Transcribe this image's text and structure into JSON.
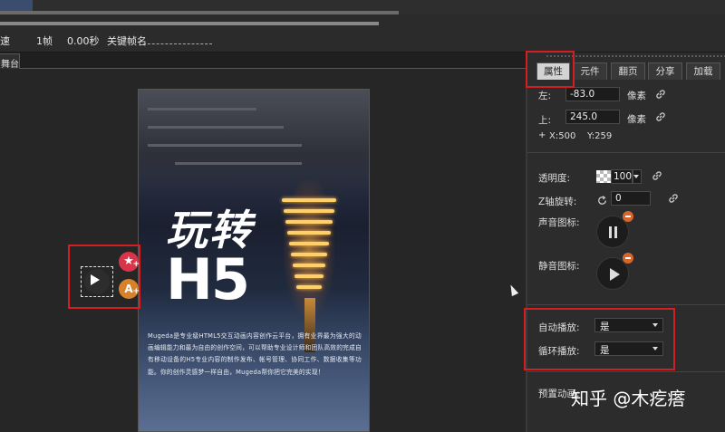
{
  "timeline": {
    "speed_label": "速",
    "frame_label": "1帧",
    "time_label": "0.00秒",
    "keyframe_name_label": "关键帧名"
  },
  "stage": {
    "tab_label": "舞台",
    "title_cn": "玩转",
    "title_h5": "H5",
    "description": "Mugeda是专业级HTML5交互动画内容创作云平台，拥有业界最为强大的动画编辑能力和最为自由的创作空间，可以帮助专业设计师和团队高效的完成自有移动设备的H5专业内容的制作发布、帐号管理、协同工作、数据收集等功能。你的创作灵感梦一样自由，Mugeda帮你把它完美的实现！"
  },
  "panel": {
    "tabs": [
      {
        "label": "属性",
        "active": true
      },
      {
        "label": "元件",
        "active": false
      },
      {
        "label": "翻页",
        "active": false
      },
      {
        "label": "分享",
        "active": false
      },
      {
        "label": "加载",
        "active": false
      }
    ],
    "left_label": "左:",
    "left_value": "-83.0",
    "top_label": "上:",
    "top_value": "245.0",
    "unit_px": "像素",
    "pos_x": "X:500",
    "pos_y": "Y:259",
    "plus_sign": "+",
    "opacity_label": "透明度:",
    "opacity_value": "100",
    "z_rotation_label": "Z轴旋转:",
    "z_rotation_value": "0",
    "sound_icon_label": "声音图标:",
    "mute_icon_label": "静音图标:",
    "autoplay_label": "自动播放:",
    "autoplay_value": "是",
    "loop_label": "循环播放:",
    "loop_value": "是",
    "preset_anim_label": "预置动画:"
  },
  "watermark": "知乎 @木疙瘩",
  "colors": {
    "highlight_red": "#d21f1f",
    "active_tab_bg": "#d3d3d3",
    "badge_orange": "#d8662b",
    "badge_pink": "#d8354b"
  }
}
